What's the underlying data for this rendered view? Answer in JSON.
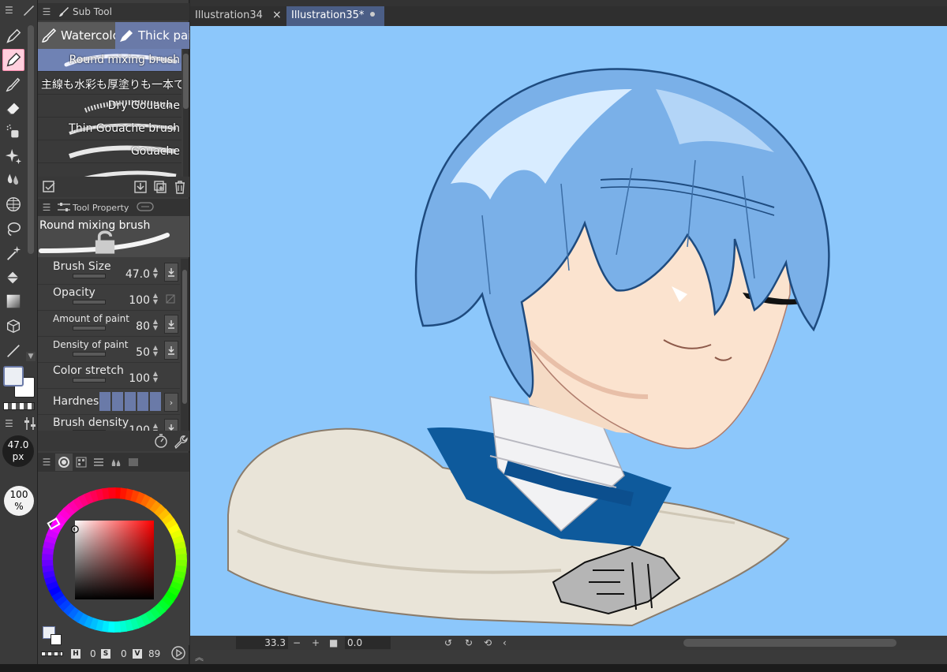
{
  "panels": {
    "sub_tool": {
      "title": "Sub Tool",
      "tabs": [
        {
          "label": "Watercolor"
        },
        {
          "label": "Thick paint"
        }
      ],
      "brushes": [
        {
          "label": "Round mixing brush",
          "selected": true
        },
        {
          "label": "主線も水彩も厚塗りも一本で"
        },
        {
          "label": "Dry Gouache"
        },
        {
          "label": "Thin Gouache brush"
        },
        {
          "label": "Gouache"
        }
      ]
    },
    "tool_property": {
      "title": "Tool Property",
      "brush_name": "Round mixing brush",
      "rows": [
        {
          "label": "Brush Size",
          "value": "47.0"
        },
        {
          "label": "Opacity",
          "value": "100"
        },
        {
          "label": "Amount of paint",
          "value": "80"
        },
        {
          "label": "Density of paint",
          "value": "50"
        },
        {
          "label": "Color stretch",
          "value": "100"
        },
        {
          "label": "Hardness",
          "value": ""
        },
        {
          "label": "Brush density",
          "value": "100"
        }
      ]
    },
    "color": {
      "h_label": "H",
      "h_value": "0",
      "s_label": "S",
      "s_value": "0",
      "v_label": "V",
      "v_value": "89"
    }
  },
  "toolbar": {
    "brush_size": "47.0",
    "brush_size_unit": "px",
    "opacity": "100",
    "opacity_unit": "%"
  },
  "documents": {
    "tabs": [
      {
        "label": "Illustration34",
        "active": false
      },
      {
        "label": "Illustration35*",
        "active": true
      }
    ]
  },
  "status": {
    "zoom": "33.3",
    "rotation": "0.0"
  },
  "colors": {
    "canvas_bg": "#8cc7fb",
    "accent": "#6f82b4",
    "active_tool": "#ffd0de",
    "main_color": "#eceff4",
    "sub_color": "#ffffff"
  }
}
